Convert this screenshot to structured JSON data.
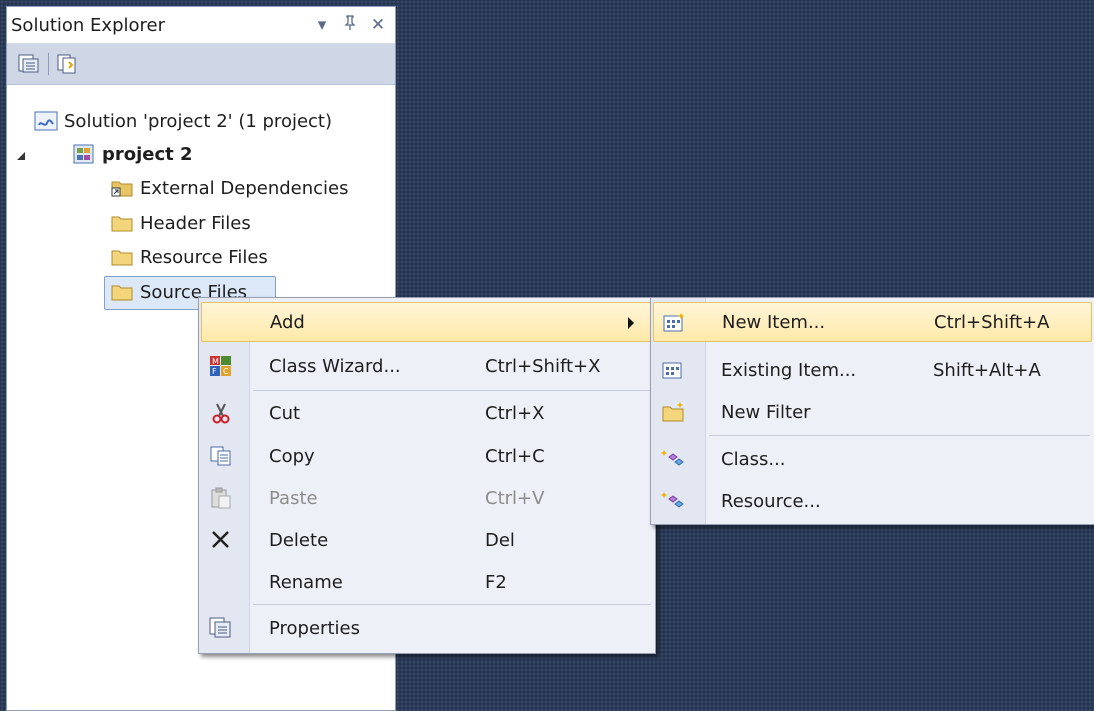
{
  "panel": {
    "title": "Solution Explorer",
    "header_icons": [
      "dropdown-arrow-icon",
      "pin-icon",
      "close-icon"
    ],
    "toolbar_icons": [
      "properties-icon",
      "show-all-files-icon"
    ]
  },
  "tree": {
    "solution": "Solution 'project 2' (1 project)",
    "project": "project 2",
    "items": [
      "External Dependencies",
      "Header Files",
      "Resource Files",
      "Source Files"
    ]
  },
  "context_menu": {
    "items": [
      {
        "label": "Add",
        "shortcut": "",
        "icon": "",
        "submenu": true
      },
      {
        "label": "Class Wizard...",
        "shortcut": "Ctrl+Shift+X",
        "icon": "mfc-class-wizard-icon"
      },
      {
        "label": "Cut",
        "shortcut": "Ctrl+X",
        "icon": "scissors-icon"
      },
      {
        "label": "Copy",
        "shortcut": "Ctrl+C",
        "icon": "copy-icon"
      },
      {
        "label": "Paste",
        "shortcut": "Ctrl+V",
        "icon": "paste-icon",
        "disabled": true
      },
      {
        "label": "Delete",
        "shortcut": "Del",
        "icon": "delete-x-icon"
      },
      {
        "label": "Rename",
        "shortcut": "F2",
        "icon": ""
      },
      {
        "label": "Properties",
        "shortcut": "",
        "icon": "properties-icon"
      }
    ]
  },
  "submenu": {
    "items": [
      {
        "label": "New Item...",
        "shortcut": "Ctrl+Shift+A",
        "icon": "new-item-icon"
      },
      {
        "label": "Existing Item...",
        "shortcut": "Shift+Alt+A",
        "icon": "existing-item-icon"
      },
      {
        "label": "New Filter",
        "shortcut": "",
        "icon": "new-folder-icon"
      },
      {
        "label": "Class...",
        "shortcut": "",
        "icon": "add-class-icon"
      },
      {
        "label": "Resource...",
        "shortcut": "",
        "icon": "add-resource-icon"
      }
    ]
  },
  "colors": {
    "background": "#2b3c5a",
    "menu_background": "#edf0f7",
    "highlight": "#ffe9a8",
    "selection": "#dce8f7"
  }
}
